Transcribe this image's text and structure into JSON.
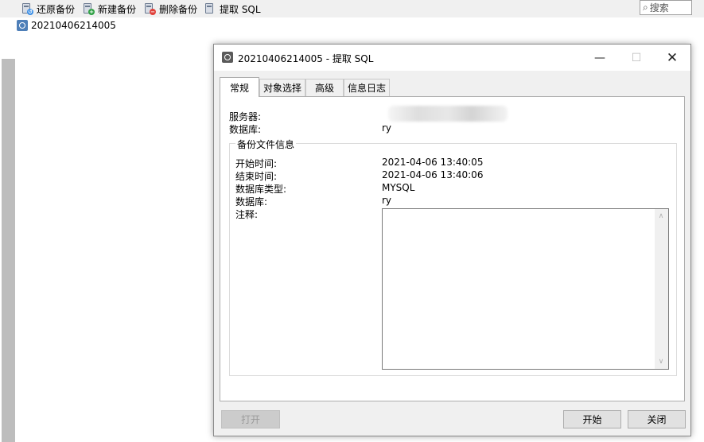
{
  "toolbar": {
    "restore_label": "还原备份",
    "new_label": "新建备份",
    "delete_label": "删除备份",
    "extract_label": "提取 SQL",
    "search_placeholder": "搜索"
  },
  "tree": {
    "item_label": "20210406214005"
  },
  "dialog": {
    "title": "20210406214005 - 提取 SQL",
    "tabs": [
      {
        "label": "常规"
      },
      {
        "label": "对象选择"
      },
      {
        "label": "高级"
      },
      {
        "label": "信息日志"
      }
    ],
    "general": {
      "server_label": "服务器:",
      "server_value": "",
      "database_label": "数据库:",
      "database_value": "ry"
    },
    "backup_info": {
      "group_title": "备份文件信息",
      "start_time_label": "开始时间:",
      "start_time_value": "2021-04-06 13:40:05",
      "end_time_label": "结束时间:",
      "end_time_value": "2021-04-06 13:40:06",
      "db_type_label": "数据库类型:",
      "db_type_value": "MYSQL",
      "database_label": "数据库:",
      "database_value": "ry",
      "notes_label": "注释:",
      "notes_value": ""
    },
    "buttons": {
      "open_label": "打开",
      "start_label": "开始",
      "close_label": "关闭"
    }
  },
  "colors": {
    "restore_badge": "#3a8ee6",
    "new_badge": "#2ea043",
    "delete_badge": "#e0403a"
  }
}
